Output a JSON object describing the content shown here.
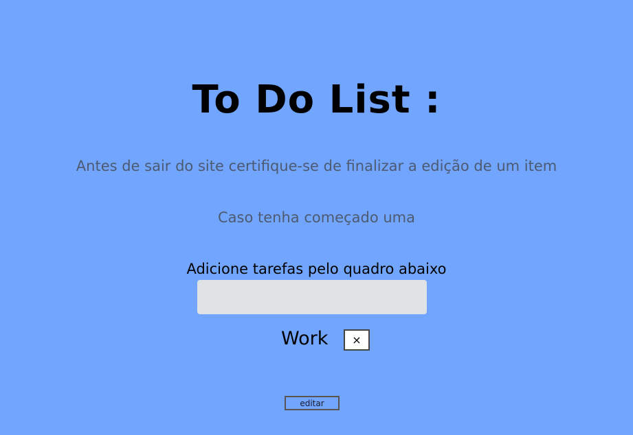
{
  "header": {
    "title": "To Do List :"
  },
  "notices": {
    "line1": "Antes de sair do site certifique-se de finalizar a edição de um item",
    "line2": "Caso tenha começado uma"
  },
  "form": {
    "instruction": "Adicione tarefas pelo quadro abaixo",
    "input_value": "",
    "input_placeholder": ""
  },
  "tasks": [
    {
      "label": "Work",
      "delete_label": "×"
    }
  ],
  "actions": {
    "edit_label": "editar"
  },
  "colors": {
    "background": "#71a5fe",
    "input_background": "#dfe3e5",
    "notice_text": "#4d5a70"
  }
}
